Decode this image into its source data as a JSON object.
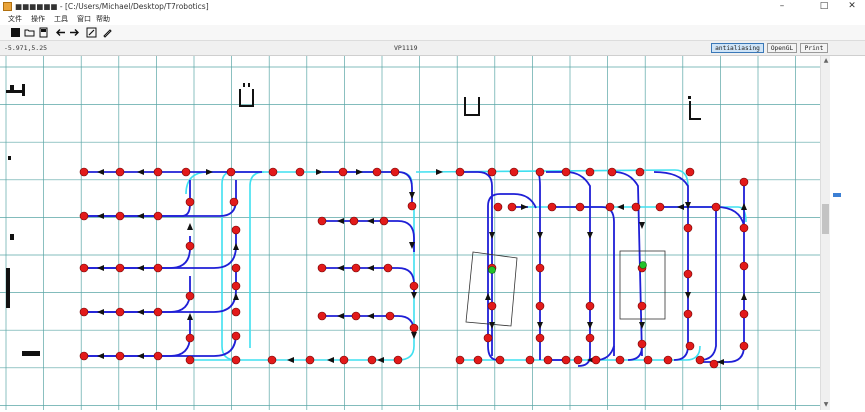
{
  "window": {
    "title": "■■■■■■ - [C:/Users/Michael/Desktop/T7robotics]",
    "controls": {
      "minimize": "–",
      "maximize": "□",
      "close": "✕"
    }
  },
  "menu": [
    "文件",
    "操作",
    "工具",
    "窗口",
    "帮助"
  ],
  "toolbar": {
    "tools": [
      "new-file-icon",
      "open-folder-icon",
      "save-icon",
      "back-arrow-icon",
      "forward-arrow-icon",
      "edit-icon",
      "pen-icon"
    ]
  },
  "status": {
    "coords": "-5.971,5.25",
    "scale": "VP1119",
    "mode_buttons": [
      {
        "label": "antialiasing",
        "active": true
      },
      {
        "label": "OpenGL",
        "active": false
      },
      {
        "label": "Print",
        "active": false
      }
    ]
  },
  "colors": {
    "grid": "#5aa6a6",
    "path_main": "#1f1fd6",
    "path_cyan": "#3fe0f0",
    "node": "#e21a1a",
    "node_green": "#22c22a"
  }
}
